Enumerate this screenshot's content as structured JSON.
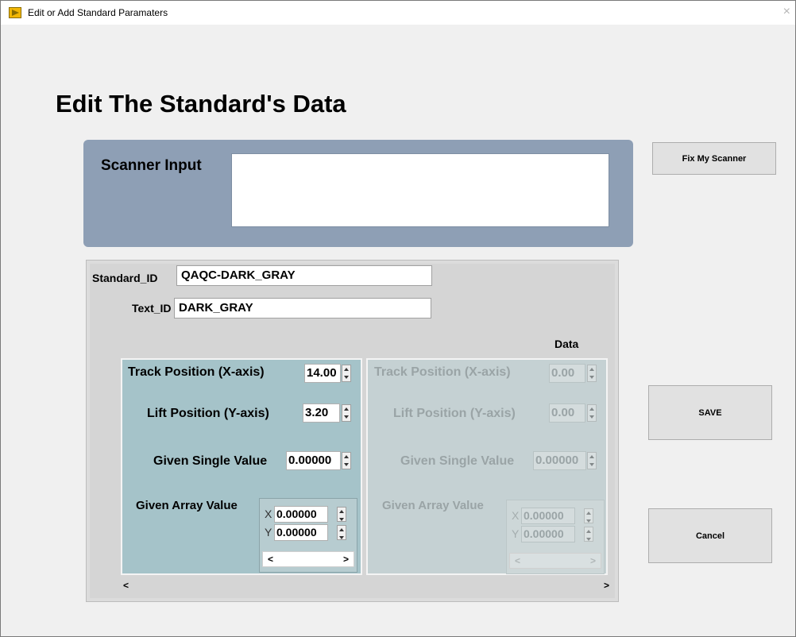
{
  "window": {
    "title": "Edit or Add Standard Paramaters",
    "close_glyph": "×"
  },
  "heading": "Edit The Standard's Data",
  "scanner": {
    "label": "Scanner Input",
    "value": ""
  },
  "buttons": {
    "fix_scanner": "Fix My Scanner",
    "save": "SAVE",
    "cancel": "Cancel"
  },
  "fields": {
    "standard_id": {
      "label": "Standard_ID",
      "value": "QAQC-DARK_GRAY"
    },
    "text_id": {
      "label": "Text_ID",
      "value": "DARK_GRAY"
    }
  },
  "data_label": "Data",
  "clusters": [
    {
      "track": {
        "label": "Track Position (X-axis)",
        "value": "14.00"
      },
      "lift": {
        "label": "Lift Position (Y-axis)",
        "value": "3.20"
      },
      "single": {
        "label": "Given Single Value",
        "value": "0.00000"
      },
      "array": {
        "label": "Given Array Value",
        "x_label": "X",
        "x_value": "0.00000",
        "y_label": "Y",
        "y_value": "0.00000"
      }
    },
    {
      "track": {
        "label": "Track Position (X-axis)",
        "value": "0.00"
      },
      "lift": {
        "label": "Lift Position (Y-axis)",
        "value": "0.00"
      },
      "single": {
        "label": "Given Single Value",
        "value": "0.00000"
      },
      "array": {
        "label": "Given Array Value",
        "x_label": "X",
        "x_value": "0.00000",
        "y_label": "Y",
        "y_value": "0.00000"
      }
    }
  ],
  "scroll": {
    "left": "<",
    "right": ">"
  },
  "icons": {
    "app": "labview-vi-icon"
  }
}
